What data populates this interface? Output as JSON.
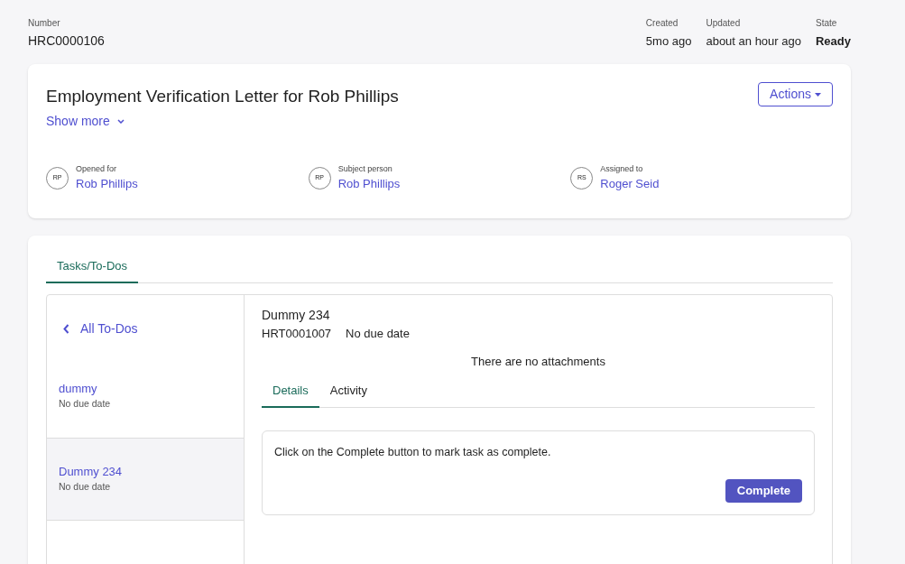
{
  "header": {
    "number_label": "Number",
    "number": "HRC0000106",
    "meta": [
      {
        "label": "Created",
        "value": "5mo ago",
        "kind": "plain"
      },
      {
        "label": "Updated",
        "value": "about an hour ago",
        "kind": "plain"
      },
      {
        "label": "State",
        "value": "Ready",
        "kind": "strong"
      }
    ]
  },
  "case": {
    "title": "Employment Verification Letter for Rob Phillips",
    "show_more": "Show more",
    "actions": "Actions",
    "people": [
      {
        "initials": "RP",
        "label": "Opened for",
        "name": "Rob Phillips"
      },
      {
        "initials": "RP",
        "label": "Subject person",
        "name": "Rob Phillips"
      },
      {
        "initials": "RS",
        "label": "Assigned to",
        "name": "Roger Seid"
      }
    ]
  },
  "tabs": [
    {
      "label": "Tasks/To-Dos",
      "selected": true
    }
  ],
  "todos": {
    "back": "All To-Dos",
    "items": [
      {
        "title": "dummy",
        "due": "No due date",
        "selected": false
      },
      {
        "title": "Dummy 234",
        "due": "No due date",
        "selected": true
      }
    ]
  },
  "task": {
    "title": "Dummy 234",
    "number": "HRT0001007",
    "due": "No due date",
    "attachments": "There are no attachments",
    "tabs": [
      {
        "label": "Details",
        "selected": true
      },
      {
        "label": "Activity",
        "selected": false
      }
    ],
    "message": "Click on the Complete button to mark task as complete.",
    "complete": "Complete"
  }
}
